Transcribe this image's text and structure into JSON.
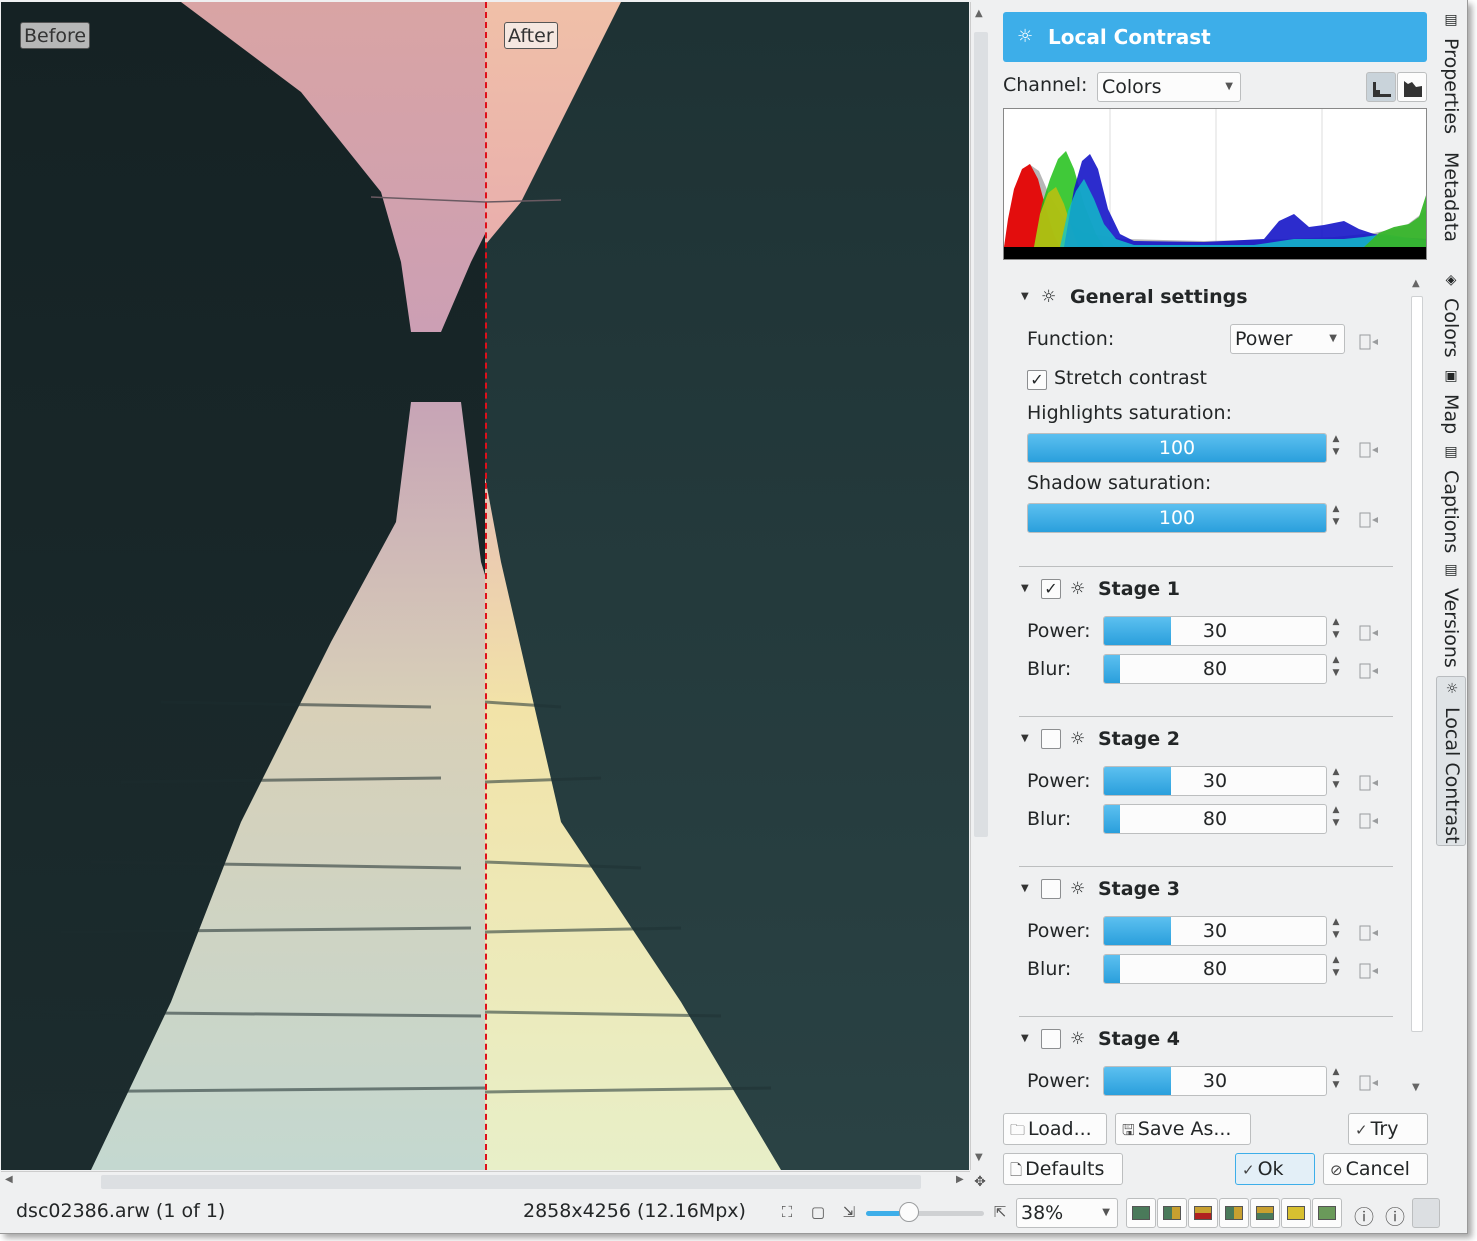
{
  "preview": {
    "before_label": "Before",
    "after_label": "After"
  },
  "tool": {
    "title": "Local Contrast",
    "channel_label": "Channel:",
    "channel_value": "Colors"
  },
  "general": {
    "title": "General settings",
    "function_label": "Function:",
    "function_value": "Power",
    "stretch_label": "Stretch contrast",
    "stretch_checked": true,
    "highlights_label": "Highlights saturation:",
    "highlights_value": "100",
    "highlights_fraction": 1.0,
    "shadow_label": "Shadow saturation:",
    "shadow_value": "100",
    "shadow_fraction": 1.0
  },
  "stages": [
    {
      "title": "Stage 1",
      "enabled": true,
      "power_label": "Power:",
      "power_value": "30",
      "power_fraction": 0.3,
      "blur_label": "Blur:",
      "blur_value": "80",
      "blur_fraction": 0.07
    },
    {
      "title": "Stage 2",
      "enabled": false,
      "power_label": "Power:",
      "power_value": "30",
      "power_fraction": 0.3,
      "blur_label": "Blur:",
      "blur_value": "80",
      "blur_fraction": 0.07
    },
    {
      "title": "Stage 3",
      "enabled": false,
      "power_label": "Power:",
      "power_value": "30",
      "power_fraction": 0.3,
      "blur_label": "Blur:",
      "blur_value": "80",
      "blur_fraction": 0.07
    },
    {
      "title": "Stage 4",
      "enabled": false,
      "power_label": "Power:",
      "power_value": "30",
      "power_fraction": 0.3
    }
  ],
  "buttons": {
    "load": "Load...",
    "save_as": "Save As...",
    "try": "Try",
    "defaults": "Defaults",
    "ok": "Ok",
    "cancel": "Cancel"
  },
  "sidetabs": [
    "Properties",
    "Metadata",
    "Colors",
    "Map",
    "Captions",
    "Versions",
    "Local Contrast"
  ],
  "status": {
    "file": "dsc02386.arw (1 of 1)",
    "dimensions": "2858x4256 (12.16Mpx)",
    "zoom": "38%",
    "zoom_fraction": 0.3
  },
  "colors": {
    "accent": "#3daee9",
    "split_line": "#e0101a"
  }
}
